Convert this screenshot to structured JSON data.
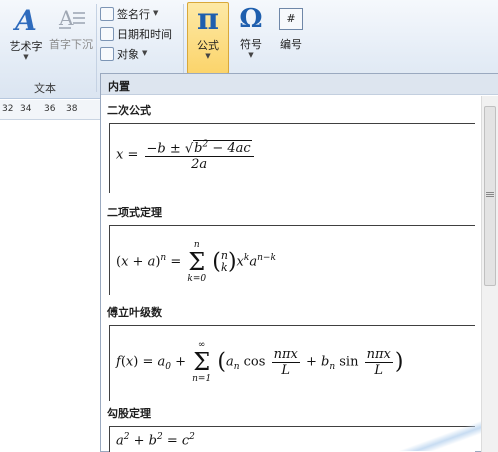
{
  "ribbon": {
    "wordart_label": "艺术字",
    "dropcap_label": "首字下沉",
    "signature_label": "签名行",
    "datetime_label": "日期和时间",
    "object_label": "对象",
    "group_label": "文本",
    "equation_label": "公式",
    "symbol_label": "符号",
    "number_label": "编号",
    "number_icon_text": "#",
    "pi_glyph": "π",
    "omega_glyph": "Ω",
    "wordart_glyph": "A"
  },
  "ruler": {
    "ticks": [
      "32",
      "34",
      "36",
      "38"
    ]
  },
  "gallery": {
    "header": "内置",
    "items": [
      {
        "title": "二次公式",
        "formula_text": "x = (−b ± √(b² − 4ac)) / 2a"
      },
      {
        "title": "二项式定理",
        "formula_text": "(x + a)ⁿ = Σₖ₌₀ⁿ (n k) xᵏ aⁿ⁻ᵏ"
      },
      {
        "title": "傅立叶级数",
        "formula_text": "f(x) = a₀ + Σₙ₌₁^∞ (aₙ cos(nπx/L) + bₙ sin(nπx/L))"
      },
      {
        "title": "勾股定理",
        "formula_text": "a² + b² = c²"
      }
    ]
  },
  "colors": {
    "accent": "#1f5fae",
    "selected_button": "#fbd46b",
    "ribbon_bg": "#dbe5f1"
  }
}
